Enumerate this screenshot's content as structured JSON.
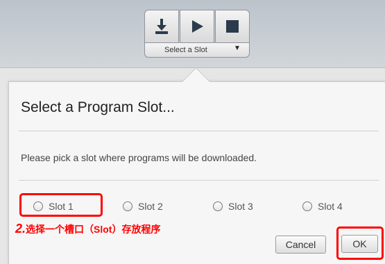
{
  "toolbar": {
    "slot_selector_label": "Select a Slot",
    "download_icon": "download-icon",
    "run_icon": "play-icon",
    "stop_icon": "stop-icon"
  },
  "dialog": {
    "title": "Select a Program Slot...",
    "message": "Please pick a slot where programs will be downloaded.",
    "slots": [
      "Slot 1",
      "Slot 2",
      "Slot 3",
      "Slot 4"
    ],
    "cancel_label": "Cancel",
    "ok_label": "OK"
  },
  "annotation": {
    "step": "2.",
    "text": "选择一个槽口（Slot）存放程序",
    "color": "#ff0000"
  }
}
